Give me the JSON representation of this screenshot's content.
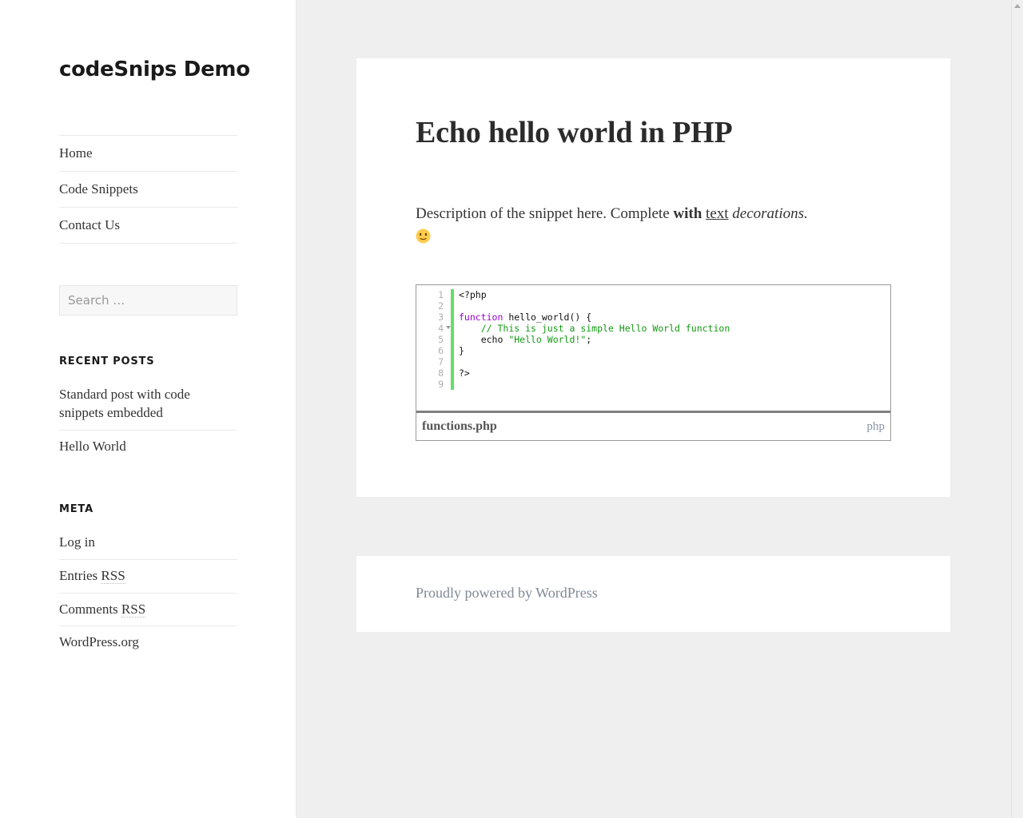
{
  "site": {
    "title": "codeSnips Demo"
  },
  "nav": {
    "items": [
      {
        "label": "Home",
        "name": "nav-item-home"
      },
      {
        "label": "Code Snippets",
        "name": "nav-item-code-snippets"
      },
      {
        "label": "Contact Us",
        "name": "nav-item-contact-us"
      }
    ]
  },
  "search": {
    "placeholder": "Search …",
    "value": ""
  },
  "widgets": {
    "recent_posts": {
      "title": "Recent Posts",
      "items": [
        "Standard post with code snippets embedded",
        "Hello World"
      ]
    },
    "meta": {
      "title": "Meta",
      "items": [
        {
          "label": "Log in",
          "abbr": ""
        },
        {
          "label": "Entries ",
          "abbr": "RSS"
        },
        {
          "label": "Comments ",
          "abbr": "RSS"
        },
        {
          "label": "WordPress.org",
          "abbr": ""
        }
      ]
    }
  },
  "article": {
    "title": "Echo hello world in PHP",
    "description": {
      "part1": "Description of the snippet here. Complete ",
      "bold": "with",
      "space1": " ",
      "underline": "text",
      "space2": " ",
      "italic": "decorations.",
      "emoji": "slightly-smiling-face"
    }
  },
  "snippet": {
    "filename": "functions.php",
    "language": "php",
    "line_numbers": [
      "1",
      "2",
      "3",
      "4",
      "5",
      "6",
      "7",
      "8",
      "9"
    ],
    "fold_marker_line": 4,
    "gutter_bar_color": "#64df64",
    "colors": {
      "keyword": "#9a00cd",
      "comment": "#119911",
      "string": "#119911",
      "text": "#111111"
    },
    "lines": [
      {
        "tokens": [
          {
            "t": "<?php",
            "c": "txt"
          }
        ]
      },
      {
        "tokens": []
      },
      {
        "tokens": [
          {
            "t": "function",
            "c": "kw"
          },
          {
            "t": " hello_world() {",
            "c": "txt"
          }
        ]
      },
      {
        "tokens": [
          {
            "t": "    ",
            "c": "txt"
          },
          {
            "t": "// This is just a simple Hello World function",
            "c": "com"
          }
        ]
      },
      {
        "tokens": [
          {
            "t": "    echo ",
            "c": "txt"
          },
          {
            "t": "\"Hello World!\"",
            "c": "str"
          },
          {
            "t": ";",
            "c": "txt"
          }
        ]
      },
      {
        "tokens": [
          {
            "t": "}",
            "c": "txt"
          }
        ]
      },
      {
        "tokens": []
      },
      {
        "tokens": [
          {
            "t": "?>",
            "c": "txt"
          }
        ]
      },
      {
        "tokens": []
      }
    ]
  },
  "footer": {
    "credit": "Proudly powered by WordPress"
  }
}
